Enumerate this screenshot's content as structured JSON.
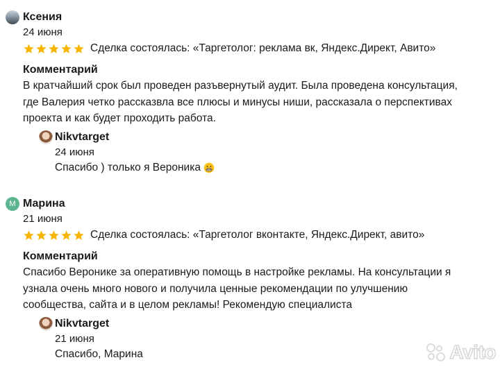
{
  "reviews": [
    {
      "author": "Ксения",
      "avatar_type": "photo",
      "date": "24 июня",
      "rating": 5,
      "deal": "Сделка состоялась: «Таргетолог: реклама вк, Яндекс.Директ, Авито»",
      "comment_label": "Комментарий",
      "comment_lines": [
        "В кратчайший срок был проведен разъвернутый аудит. Была проведена консультация,",
        "где Валерия четко рассказвла все плюсы и минусы ниши, рассказала о перспективах",
        "проекта и как будет проходить работа."
      ],
      "reply": {
        "author": "Nikvtarget",
        "date": "24 июня",
        "text": "Спасибо ) только я Вероника",
        "emoji": "grimacing-face-icon"
      }
    },
    {
      "author": "Марина",
      "avatar_letter": "М",
      "avatar_color": "#5db58f",
      "date": "21 июня",
      "rating": 5,
      "deal": "Сделка состоялась: «Таргетолог вконтакте, Яндекс.Директ, авито»",
      "comment_label": "Комментарий",
      "comment_lines": [
        "Спасибо Веронике за оперативную помощь в настройке рекламы. На консультации я",
        "узнала очень много нового и получила ценные рекомендации по улучшению",
        "сообщества, сайта и в целом рекламы! Рекомендую специалиста"
      ],
      "reply": {
        "author": "Nikvtarget",
        "date": "21 июня",
        "text": "Спасибо, Марина"
      }
    }
  ],
  "star_color": "#f7b500",
  "watermark": "Avito"
}
